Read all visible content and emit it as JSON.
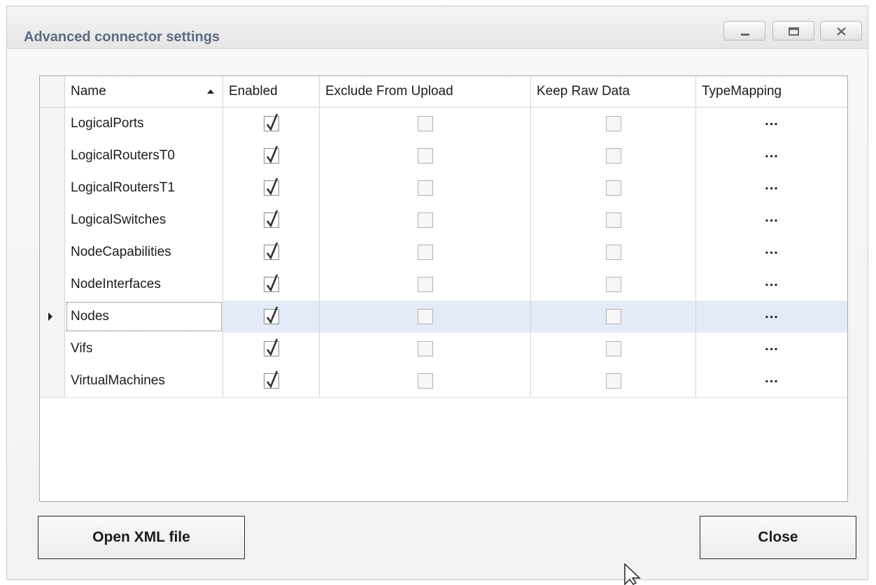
{
  "window": {
    "title": "Advanced connector settings",
    "controls": [
      "minimize",
      "maximize",
      "close"
    ]
  },
  "grid": {
    "columns": [
      "Name",
      "Enabled",
      "Exclude From Upload",
      "Keep Raw Data",
      "TypeMapping"
    ],
    "sort": {
      "column": "Name",
      "direction": "ascending"
    },
    "current_row": "Nodes",
    "rows": [
      {
        "name": "LogicalPorts",
        "enabled": true,
        "exclude_from_upload": false,
        "keep_raw_data": false,
        "type_mapping": "..."
      },
      {
        "name": "LogicalRoutersT0",
        "enabled": true,
        "exclude_from_upload": false,
        "keep_raw_data": false,
        "type_mapping": "..."
      },
      {
        "name": "LogicalRoutersT1",
        "enabled": true,
        "exclude_from_upload": false,
        "keep_raw_data": false,
        "type_mapping": "..."
      },
      {
        "name": "LogicalSwitches",
        "enabled": true,
        "exclude_from_upload": false,
        "keep_raw_data": false,
        "type_mapping": "..."
      },
      {
        "name": "NodeCapabilities",
        "enabled": true,
        "exclude_from_upload": false,
        "keep_raw_data": false,
        "type_mapping": "..."
      },
      {
        "name": "NodeInterfaces",
        "enabled": true,
        "exclude_from_upload": false,
        "keep_raw_data": false,
        "type_mapping": "..."
      },
      {
        "name": "Nodes",
        "enabled": true,
        "exclude_from_upload": false,
        "keep_raw_data": false,
        "type_mapping": "..."
      },
      {
        "name": "Vifs",
        "enabled": true,
        "exclude_from_upload": false,
        "keep_raw_data": false,
        "type_mapping": "..."
      },
      {
        "name": "VirtualMachines",
        "enabled": true,
        "exclude_from_upload": false,
        "keep_raw_data": false,
        "type_mapping": "..."
      }
    ]
  },
  "buttons": {
    "open_xml": "Open XML file",
    "close": "Close"
  },
  "colors": {
    "title_text": "#5b6b82",
    "selected_row": "#e4ebf8",
    "grid_border": "#a9a9a9"
  }
}
